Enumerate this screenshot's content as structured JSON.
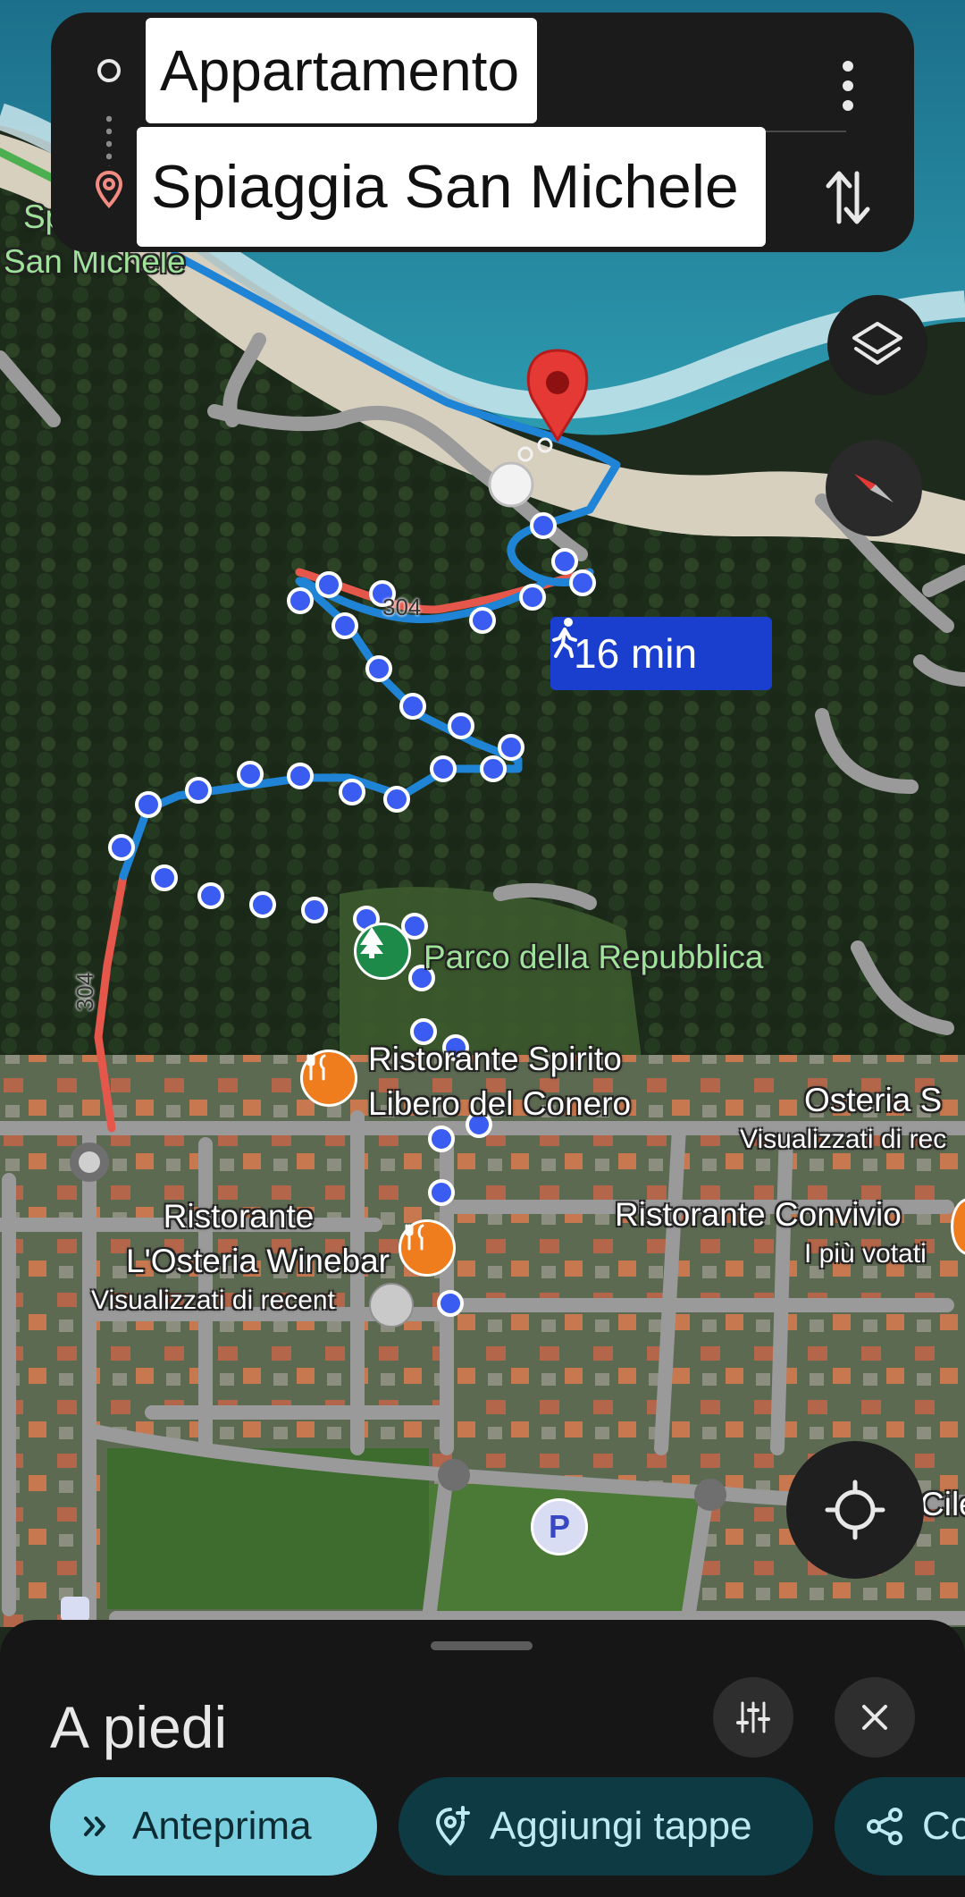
{
  "search": {
    "origin": "Appartamento",
    "destination": "Spiaggia San Michele"
  },
  "route": {
    "duration": "16 min",
    "mode_icon": "walk-icon"
  },
  "map_labels": {
    "partial_beach_top": "Sp",
    "partial_beach_bottom": "San Michele",
    "park": "Parco della Repubblica",
    "restaurant_spirito_line1": "Ristorante Spirito",
    "restaurant_spirito_line2": "Libero del Conero",
    "osteria_s": "Osteria S",
    "osteria_s_sub": "Visualizzati di rec",
    "restaurant_convivio": "Ristorante Convivio",
    "restaurant_convivio_sub": "I più votati",
    "osteria_winebar_line1": "Ristorante",
    "osteria_winebar_line2": "L'Osteria Winebar",
    "osteria_winebar_sub": "Visualizzati di recent",
    "partial_right": "Cile",
    "road_number_1": "304",
    "road_number_2": "304",
    "parking": "P"
  },
  "bottom_sheet": {
    "mode_title": "A piedi",
    "chips": {
      "preview": "Anteprima",
      "add_stops": "Aggiungi tappe",
      "share": "Co"
    }
  },
  "colors": {
    "route_blue": "#1f84d6",
    "route_red": "#e5574b",
    "step_dot": "#3a5cf0",
    "pin_red": "#e53935",
    "time_badge": "#1a3fcf",
    "chip_primary": "#79cfe0",
    "chip_secondary": "#0e3a44"
  }
}
